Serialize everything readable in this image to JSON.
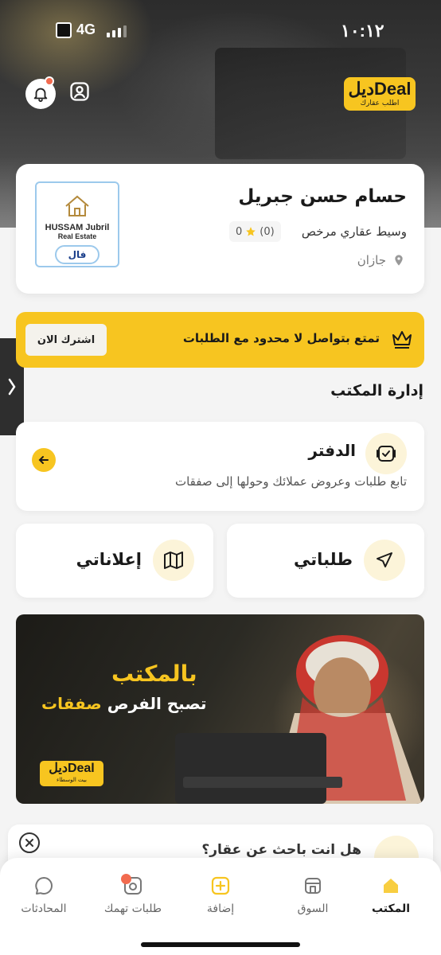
{
  "status_bar": {
    "time": "١٠:١٢",
    "network": "4G"
  },
  "header": {
    "logo_text": "ديلDeal",
    "logo_subtitle": "اطلب عقارك"
  },
  "profile": {
    "name": "حسام حسن جبريل",
    "role": "وسيط عقاري مرخص",
    "rating_count": "(0)",
    "rating_value": "0",
    "city": "جازان",
    "logo_line1": "HUSSAM Jubril",
    "logo_line2": "Real Estate",
    "logo_badge": "فال"
  },
  "promo": {
    "text": "تمتع بتواصل لا محدود مع الطلبات",
    "button": "اشترك الان"
  },
  "office": {
    "section_title": "إدارة المكتب",
    "ledger_title": "الدفتر",
    "ledger_desc": "تابع طلبات وعروض عملائك وحولها إلى صفقات",
    "requests_label": "طلباتي",
    "ads_label": "إعلاناتي"
  },
  "banner": {
    "line1": "بالمكتب",
    "line2_prefix": "تصبح الفرص",
    "line2_highlight": "صفقات",
    "logo_text": "ديلDeal",
    "logo_subtitle": "بيت الوسطاء"
  },
  "peek": {
    "text": "هل انت باحث عن عقار؟"
  },
  "tabbar": {
    "items": [
      {
        "label": "المكتب",
        "icon": "office-icon",
        "active": true
      },
      {
        "label": "السوق",
        "icon": "market-icon",
        "active": false
      },
      {
        "label": "إضافة",
        "icon": "add-icon",
        "active": false
      },
      {
        "label": "طلبات تهمك",
        "icon": "requests-icon",
        "active": false
      },
      {
        "label": "المحادثات",
        "icon": "chat-icon",
        "active": false
      }
    ]
  },
  "colors": {
    "brand_yellow": "#f7c520",
    "notification_red": "#f26b4f",
    "icon_bg": "#fcf4d9"
  }
}
